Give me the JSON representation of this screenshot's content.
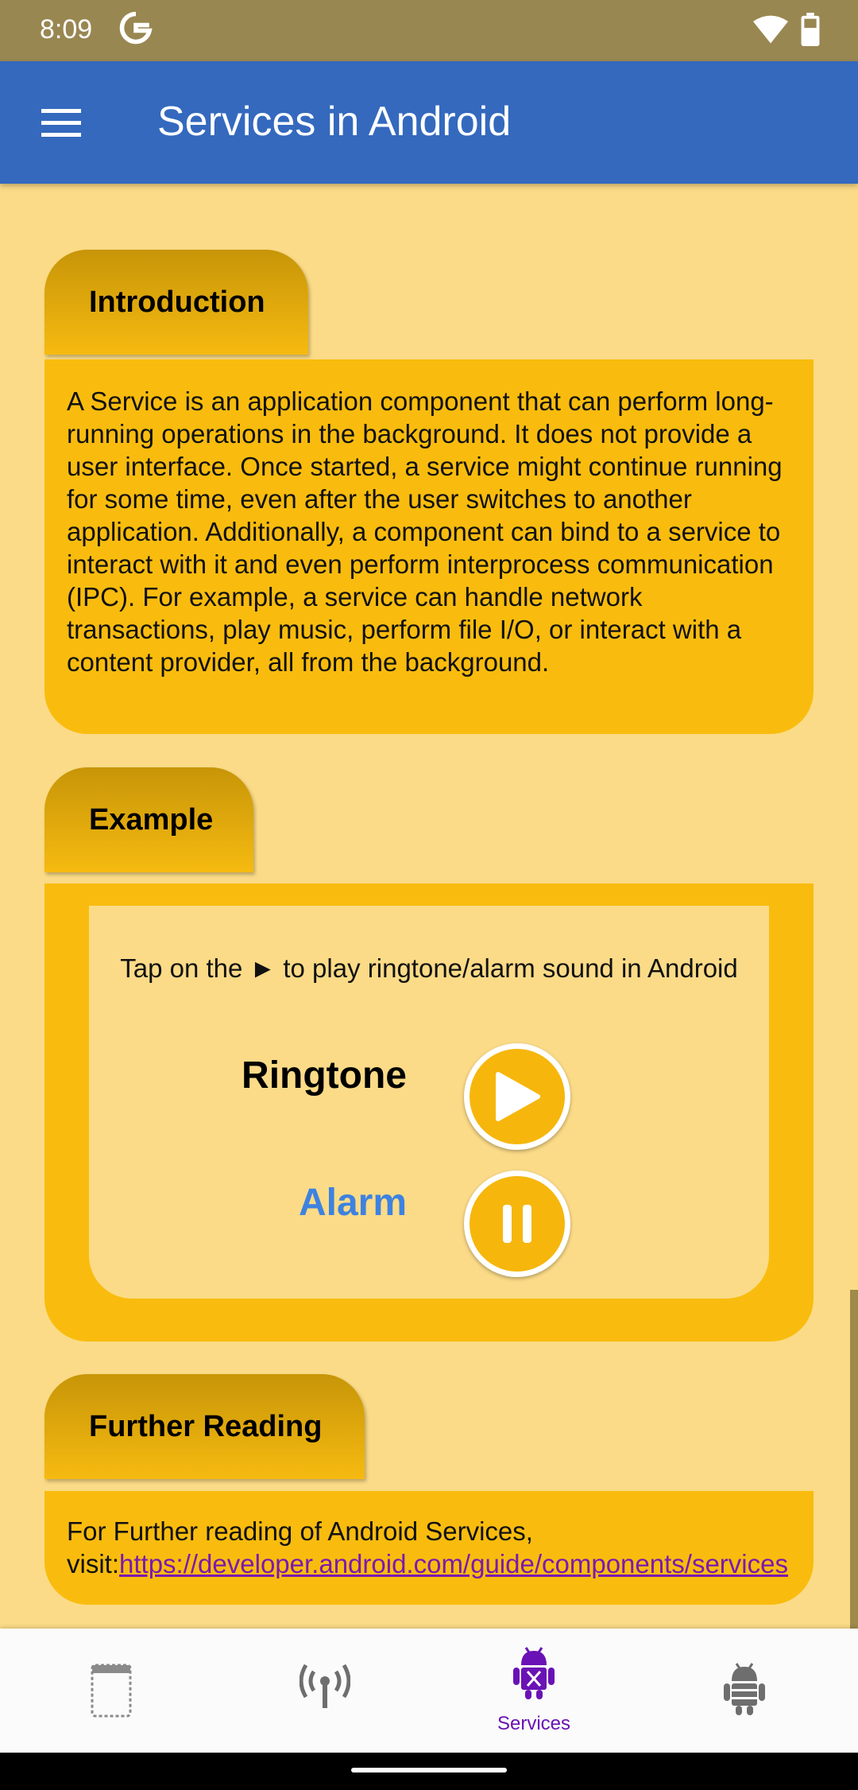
{
  "status_bar": {
    "time": "8:09"
  },
  "app_bar": {
    "title": "Services in Android"
  },
  "sections": {
    "introduction": {
      "title": "Introduction",
      "body": "A Service is an application component that can perform long-running operations in the background. It does not provide a user interface. Once started, a service might continue running for some time, even after the user switches to another application. Additionally, a component can bind to a service to interact with it and even perform interprocess communication (IPC). For example, a service can handle network transactions, play music, perform file I/O, or interact with a content provider, all from the background."
    },
    "example": {
      "title": "Example",
      "instruction": "Tap on the ► to play ringtone/alarm sound in Android",
      "ringtone_label": "Ringtone",
      "alarm_label": "Alarm"
    },
    "further_reading": {
      "title": "Further Reading",
      "text": "For Further reading of Android Services, visit:",
      "link": "https://developer.android.com/guide/components/services"
    }
  },
  "bottom_nav": {
    "items": [
      {
        "icon": "activity-icon",
        "label": ""
      },
      {
        "icon": "broadcast-icon",
        "label": ""
      },
      {
        "icon": "services-icon",
        "label": "Services"
      },
      {
        "icon": "android-icon",
        "label": ""
      }
    ],
    "active_index": 2
  },
  "colors": {
    "status_bar": "#998751",
    "app_bar": "#3469BE",
    "background": "#FBDB87",
    "card": "#F9BC0E",
    "alarm_label": "#3E82E0",
    "active_nav": "#6A12B5"
  }
}
